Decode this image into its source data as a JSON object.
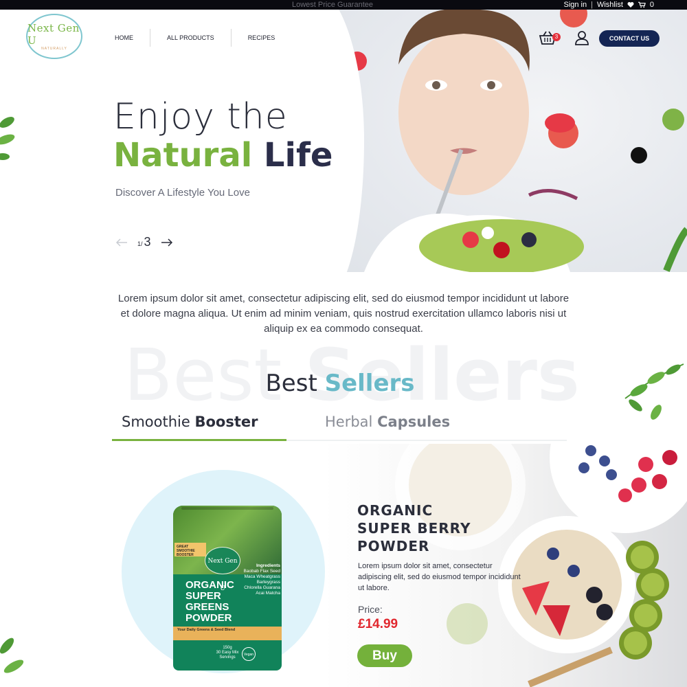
{
  "topbar": {
    "tagline": "Lowest Price Guarantee",
    "signin": "Sign in",
    "separator": "|",
    "wishlist": "Wishlist",
    "cart_count": "0"
  },
  "logo": {
    "brand": "Next Gen U",
    "sub": "NATURALLY"
  },
  "nav": {
    "items": [
      "HOME",
      "ALL PRODUCTS",
      "RECIPES"
    ]
  },
  "header": {
    "basket_count": "3",
    "contact_label": "CONTACT US"
  },
  "hero": {
    "line1": "Enjoy the",
    "line2_green": "Natural",
    "line2_dark": "Life",
    "subtitle": "Discover A Lifestyle You Love",
    "slide_current": "1/",
    "slide_total": "3"
  },
  "intro": "Lorem ipsum dolor sit amet, consectetur adipiscing elit, sed do eiusmod tempor incididunt ut labore et dolore magna aliqua. Ut enim ad minim veniam, quis nostrud exercitation ullamco laboris nisi ut aliquip ex ea commodo consequat.",
  "best_sellers": {
    "ghost_light": "Best ",
    "ghost_bold": "Sellers",
    "title_light": "Best",
    "title_bold": "Sellers"
  },
  "tabs": [
    {
      "light": "Smoothie",
      "bold": "Booster"
    },
    {
      "light": "Herbal",
      "bold": "Capsules"
    }
  ],
  "product": {
    "name": "ORGANIC SUPER BERRY POWDER",
    "description": "Lorem ipsum dolor sit amet, consectetur adipiscing elit, sed do eiusmod tempor incididunt ut labore.",
    "price_label": "Price:",
    "price": "£14.99",
    "buy_label": "Buy",
    "pouch": {
      "tag": "GREAT SMOOTHIE BOOSTER",
      "brand": "Next Gen U",
      "name": "ORGANIC SUPER GREENS POWDER",
      "ingredients_title": "Ingredients",
      "ingredients": "Baobab Flax Seed Maca Wheatgrass Barleygrass Chlorella Guarana Acai Matcha",
      "band": "Your Daily Greens & Seed Blend",
      "weight": "150g",
      "servings": "30 Easy Mix Servings",
      "vegan": "Vegan"
    }
  },
  "colors": {
    "accent_green": "#79b23f",
    "accent_teal": "#69b9c8",
    "navy": "#142554",
    "price_red": "#e1272e"
  }
}
